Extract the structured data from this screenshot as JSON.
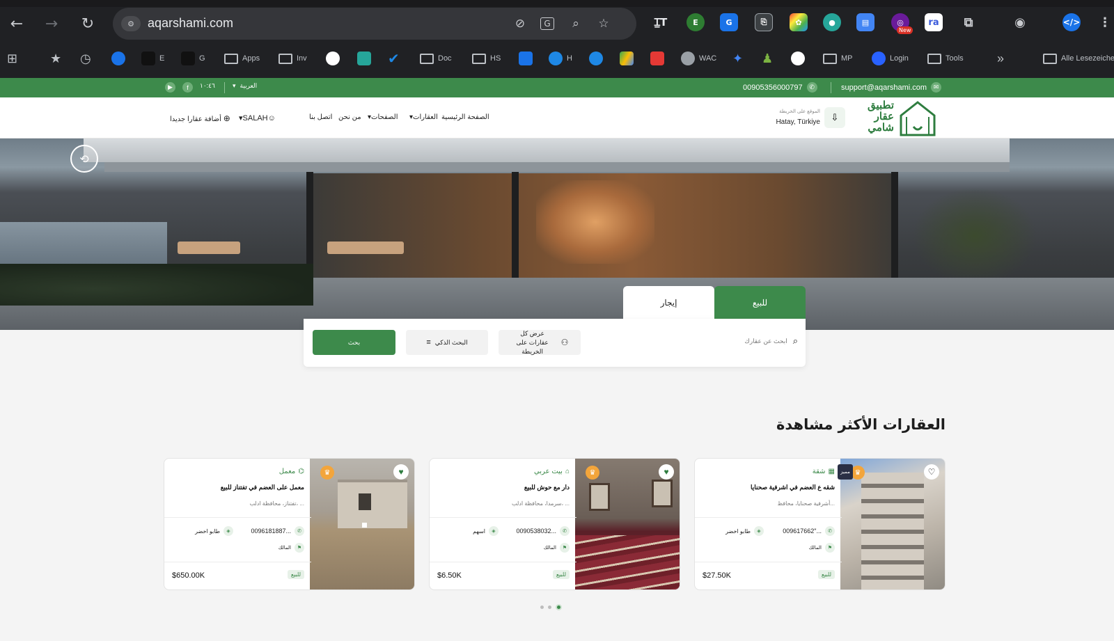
{
  "browser": {
    "url": "aqarshami.com",
    "bookmarks": [
      {
        "label": "E",
        "kind": "fav",
        "color": "#111111"
      },
      {
        "label": "G",
        "kind": "fav",
        "color": "#111111"
      },
      {
        "label": "Apps",
        "kind": "folder"
      },
      {
        "label": "Inv",
        "kind": "folder"
      },
      {
        "label": "Doc",
        "kind": "folder"
      },
      {
        "label": "HS",
        "kind": "folder"
      },
      {
        "label": "H",
        "kind": "fav",
        "color": "#1e88e5"
      },
      {
        "label": "WAC",
        "kind": "fav",
        "color": "#9aa0a6"
      },
      {
        "label": "MP",
        "kind": "folder"
      },
      {
        "label": "Login",
        "kind": "fav",
        "color": "#2962ff"
      },
      {
        "label": "Tools",
        "kind": "folder"
      },
      {
        "label": "Alle Lesezeichen",
        "kind": "folder"
      }
    ],
    "ext_badge": "New"
  },
  "topbar": {
    "email": "support@aqarshami.com",
    "phone": "00905356000797",
    "language": "العربية",
    "social_text": "١٠:٤٦"
  },
  "header": {
    "logo_lines": [
      "تطبيق",
      "عقار",
      "شامي"
    ],
    "location_label": "الموقع على الخريطة",
    "location_value": "Hatay, Türkiye",
    "nav": [
      "الصفحة الرئيسية",
      "العقارات",
      "الصفحات",
      "من نحن",
      "اتصل بنا"
    ],
    "user": "SALAH",
    "add_property": "أضافة عقارا جديدا"
  },
  "search": {
    "tab_sale": "للبيع",
    "tab_rent": "إيجار",
    "placeholder": "ابحث عن عقارك",
    "map_button": "عرض كل عقارات على الخريطة",
    "smart_button": "البحث الذكي",
    "go_button": "بحث"
  },
  "section": {
    "title": "العقارات الأكثر مشاهدة"
  },
  "cards": [
    {
      "type": "شقة",
      "title": "شقه ع العضم في اشرفية صحنايا",
      "location": "أشرفية صحنايا، محافظ...",
      "phone": "009617662\"...",
      "deed": "طابو اخضر",
      "owner": "المالك",
      "price": "$27.50K",
      "sale": "للبيع",
      "featured": "مميز",
      "heart": "♡",
      "colors": [
        "#c9c2b8",
        "#8f8a82"
      ]
    },
    {
      "type": "بيت عربي",
      "title": "دار مع حوش للبيع",
      "location": "سرمدا، محافظة ادلب، ...",
      "phone": "0090538032...",
      "deed": "اسهم",
      "owner": "المالك",
      "price": "$6.50K",
      "sale": "للبيع",
      "featured": "",
      "heart": "♥",
      "colors": [
        "#6a5e56",
        "#7a2a35"
      ]
    },
    {
      "type": "معمل",
      "title": "معمل على العضم في تفتناز للبيع",
      "location": "تفتناز، محافظة ادلب، ...",
      "phone": "0096181887...",
      "deed": "طابو اخضر",
      "owner": "المالك",
      "price": "$650.00K",
      "sale": "للبيع",
      "featured": "",
      "heart": "♥",
      "colors": [
        "#b9aea2",
        "#a89374"
      ]
    }
  ]
}
